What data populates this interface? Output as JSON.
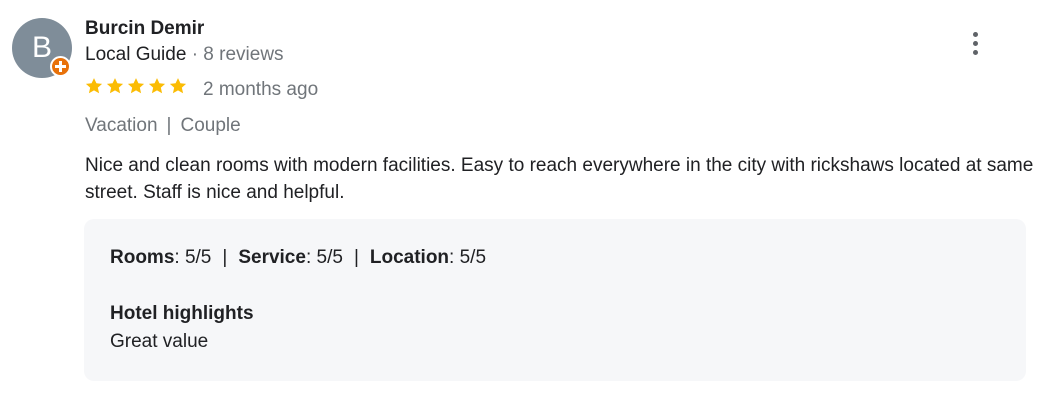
{
  "review": {
    "author": {
      "initial": "B",
      "name": "Burcin Demir",
      "badge_label": "Local Guide",
      "separator": "·",
      "reviews_count": "8 reviews"
    },
    "rating": {
      "stars": 5,
      "max_stars": 5,
      "star_color": "#fbbc04"
    },
    "time_ago": "2 months ago",
    "trip": {
      "type": "Vacation",
      "divider": "|",
      "group": "Couple"
    },
    "text": "Nice and clean rooms with modern facilities. Easy to reach everywhere in the city with rickshaws located at same street. Staff is nice and helpful.",
    "sub_ratings": [
      {
        "label": "Rooms",
        "value": ": 5/5"
      },
      {
        "label": "Service",
        "value": ": 5/5"
      },
      {
        "label": "Location",
        "value": ": 5/5"
      }
    ],
    "sub_rating_divider": "|",
    "highlights": {
      "title": "Hotel highlights",
      "value": "Great value"
    },
    "menu_icon": "more-vert-icon"
  },
  "colors": {
    "avatar_bg": "#7f8d99",
    "guide_badge": "#e8710a",
    "panel_bg": "#f6f7f9",
    "muted_text": "#70757a"
  }
}
